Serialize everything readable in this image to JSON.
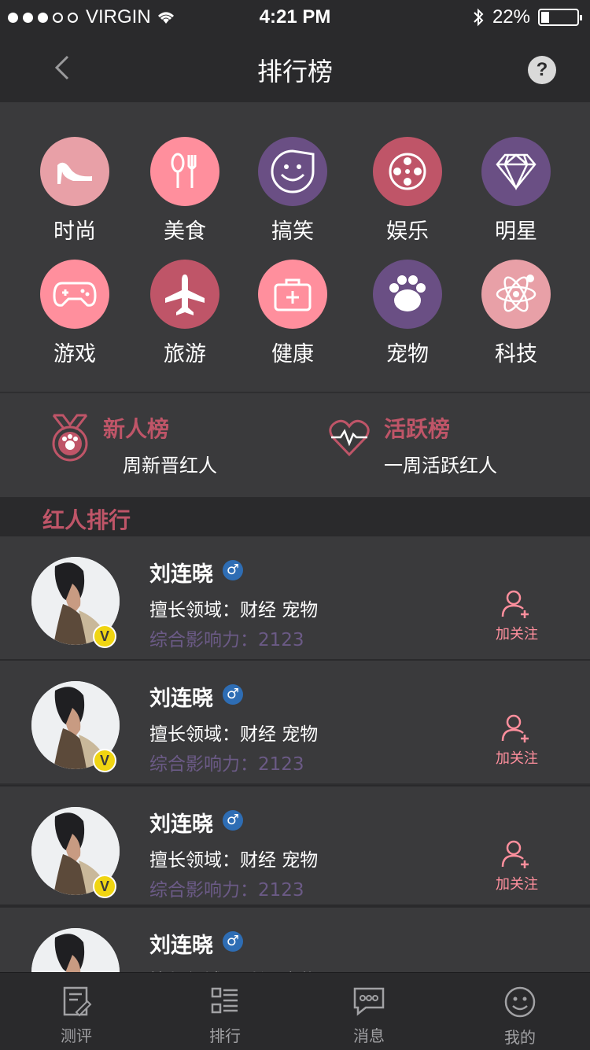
{
  "status_bar": {
    "carrier": "VIRGIN",
    "time": "4:21 PM",
    "battery": "22%"
  },
  "nav": {
    "title": "排行榜",
    "help": "?"
  },
  "categories": [
    {
      "label": "时尚",
      "color": "#e8a0a7",
      "icon": "high-heel-icon"
    },
    {
      "label": "美食",
      "color": "#ff8f9d",
      "icon": "spoon-fork-icon"
    },
    {
      "label": "搞笑",
      "color": "#6a4f84",
      "icon": "smiley-icon"
    },
    {
      "label": "娱乐",
      "color": "#bf5568",
      "icon": "film-reel-icon"
    },
    {
      "label": "明星",
      "color": "#6a4f84",
      "icon": "diamond-icon"
    },
    {
      "label": "游戏",
      "color": "#ff8f9d",
      "icon": "gamepad-icon"
    },
    {
      "label": "旅游",
      "color": "#bf5568",
      "icon": "airplane-icon"
    },
    {
      "label": "健康",
      "color": "#ff8f9d",
      "icon": "medkit-icon"
    },
    {
      "label": "宠物",
      "color": "#6a4f84",
      "icon": "paw-icon"
    },
    {
      "label": "科技",
      "color": "#e8a0a7",
      "icon": "atom-icon"
    }
  ],
  "rank_cards": [
    {
      "title": "新人榜",
      "sub": "周新晋红人",
      "icon": "medal-icon"
    },
    {
      "title": "活跃榜",
      "sub": "一周活跃红人",
      "icon": "heart-pulse-icon"
    }
  ],
  "section": {
    "title": "红人排行"
  },
  "list": [
    {
      "name": "刘连晓",
      "gender": "♂",
      "field": "擅长领域：财经   宠物",
      "influence": "综合影响力：2123",
      "follow": "加关注",
      "verified": "V"
    },
    {
      "name": "刘连晓",
      "gender": "♂",
      "field": "擅长领域：财经   宠物",
      "influence": "综合影响力：2123",
      "follow": "加关注",
      "verified": "V"
    },
    {
      "name": "刘连晓",
      "gender": "♂",
      "field": "擅长领域：财经   宠物",
      "influence": "综合影响力：2123",
      "follow": "加关注",
      "verified": "V"
    },
    {
      "name": "刘连晓",
      "gender": "♂",
      "field": "擅长领域：财经   宠物",
      "influence": "",
      "follow": "",
      "verified": ""
    }
  ],
  "tabs": [
    {
      "label": "测评",
      "icon": "review-icon"
    },
    {
      "label": "排行",
      "icon": "ranking-icon"
    },
    {
      "label": "消息",
      "icon": "message-icon"
    },
    {
      "label": "我的",
      "icon": "profile-icon"
    }
  ],
  "colors": {
    "accent": "#bf5568",
    "follow": "#ff8f9d",
    "bg": "#3a3a3c",
    "dark": "#2a2a2c"
  }
}
